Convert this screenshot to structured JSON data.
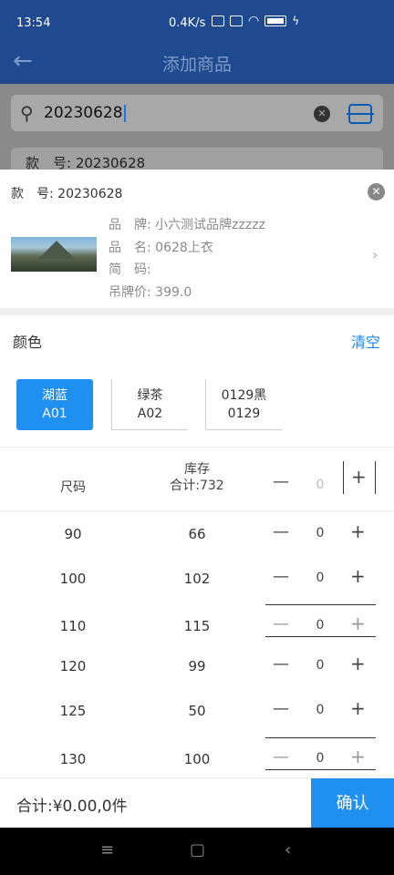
{
  "status_bar": {
    "time": "13:54",
    "network_speed": "0.4K/s",
    "battery": "100"
  },
  "app_bar": {
    "title": "添加商品"
  },
  "search": {
    "value": "20230628",
    "behind_text": "款　号: 20230628"
  },
  "product": {
    "style_no": "款　号: 20230628",
    "brand": "品　牌: 小六测试品牌zzzzz",
    "name": "品　名: 0628上衣",
    "short_code": "简　码:",
    "tag_price": "吊牌价: 399.0"
  },
  "color_section": {
    "label": "颜色",
    "clear_label": "清空"
  },
  "colors": [
    {
      "name": "湖蓝",
      "code": "A01",
      "selected": true
    },
    {
      "name": "绿茶",
      "code": "A02",
      "selected": false
    },
    {
      "name": "0129黑",
      "code": "0129",
      "selected": false
    }
  ],
  "table": {
    "size_header": "尺码",
    "stock_header": "库存",
    "stock_total": "合计:732",
    "header_qty": "0",
    "rows": [
      {
        "size": "90",
        "stock": "66",
        "qty": "0"
      },
      {
        "size": "100",
        "stock": "102",
        "qty": "0"
      },
      {
        "size": "110",
        "stock": "115",
        "qty": "0"
      },
      {
        "size": "120",
        "stock": "99",
        "qty": "0"
      },
      {
        "size": "125",
        "stock": "50",
        "qty": "0"
      },
      {
        "size": "130",
        "stock": "100",
        "qty": "0"
      }
    ]
  },
  "footer": {
    "total": "合计:¥0.00,0件",
    "confirm_label": "确认"
  },
  "icons": {
    "back": "arrow-left",
    "search": "magnifier",
    "clear": "clear-x",
    "scan": "scan-frame",
    "close": "close-circle",
    "chevron": "chevron-right",
    "minus": "minus",
    "plus": "plus"
  }
}
